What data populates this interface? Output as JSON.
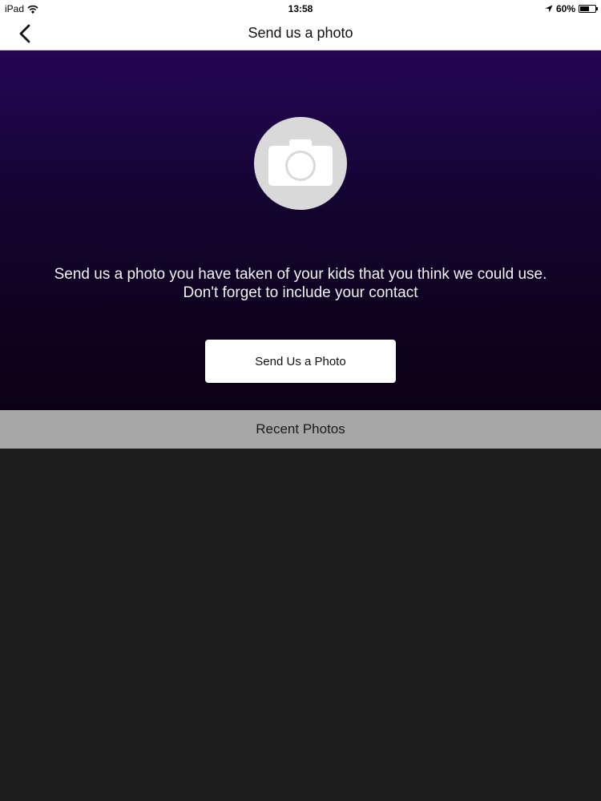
{
  "status_bar": {
    "device": "iPad",
    "wifi_icon": "wifi-icon",
    "time": "13:58",
    "location_icon": "location-arrow-icon",
    "battery_percent": "60%",
    "battery_level": 0.6
  },
  "nav": {
    "back_icon": "chevron-left-icon",
    "title": "Send us a photo"
  },
  "hero": {
    "camera_icon": "camera-icon",
    "description": "Send us a photo you have taken of your kids that you think we could use. Don't forget to include your contact",
    "button_label": "Send Us a Photo"
  },
  "recent": {
    "title": "Recent Photos"
  },
  "colors": {
    "hero_top": "#240655",
    "hero_bottom": "#0a0214",
    "section_header": "#a7a7a7",
    "background": "#1d1d1d"
  }
}
